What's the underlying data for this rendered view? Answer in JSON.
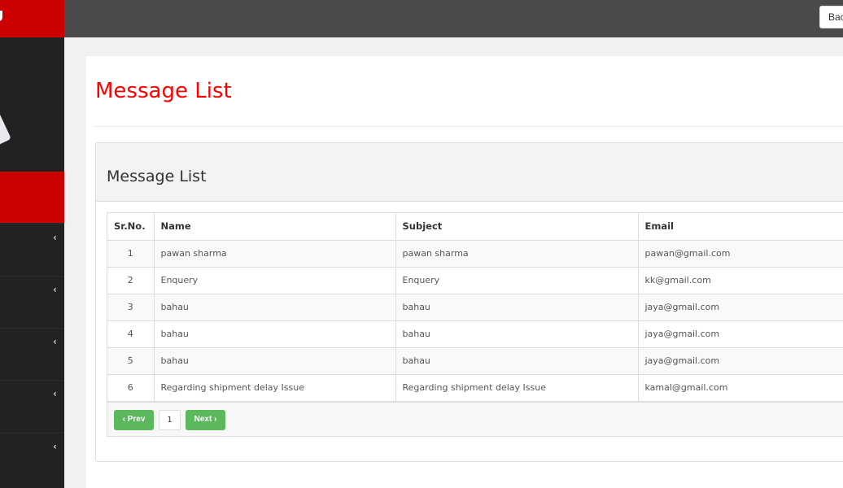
{
  "header": {
    "logo_text": "U",
    "back_button_label": "Back",
    "brand_color": "#cc0000",
    "topbar_color": "#4a4a4a"
  },
  "sidebar": {
    "avatar": "user-avatar",
    "items": [
      {
        "label": "",
        "icon": "chevron-left-icon"
      },
      {
        "label": "",
        "icon": "chevron-left-icon"
      },
      {
        "label": "",
        "icon": "chevron-left-icon"
      },
      {
        "label": "",
        "icon": "chevron-left-icon"
      },
      {
        "label": "",
        "icon": "chevron-left-icon"
      }
    ],
    "chevron_glyph": "‹"
  },
  "page": {
    "title": "Message List",
    "title_color": "#ff0000"
  },
  "card": {
    "title": "Message List"
  },
  "table": {
    "columns": [
      "Sr.No.",
      "Name",
      "Subject",
      "Email"
    ],
    "rows": [
      {
        "sr": "1",
        "name": "pawan sharma",
        "subject": "pawan sharma",
        "email": "pawan@gmail.com"
      },
      {
        "sr": "2",
        "name": "Enquery",
        "subject": "Enquery",
        "email": "kk@gmail.com"
      },
      {
        "sr": "3",
        "name": "bahau",
        "subject": "bahau",
        "email": "jaya@gmail.com"
      },
      {
        "sr": "4",
        "name": "bahau",
        "subject": "bahau",
        "email": "jaya@gmail.com"
      },
      {
        "sr": "5",
        "name": "bahau",
        "subject": "bahau",
        "email": "jaya@gmail.com"
      },
      {
        "sr": "6",
        "name": "Regarding shipment delay Issue",
        "subject": "Regarding shipment delay Issue",
        "email": "kamal@gmail.com"
      }
    ]
  },
  "pagination": {
    "prev_label": "‹ Prev",
    "current_page": "1",
    "next_label": "Next ›",
    "button_color": "#5cb85c"
  }
}
